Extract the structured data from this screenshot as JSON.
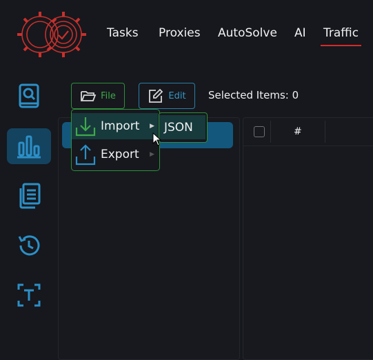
{
  "nav": {
    "items": [
      {
        "label": "Tasks"
      },
      {
        "label": "Proxies"
      },
      {
        "label": "AutoSolve"
      },
      {
        "label": "AI"
      },
      {
        "label": "Traffic"
      }
    ],
    "active": "Traffic"
  },
  "sidebar": {
    "icons": [
      "search-book-icon",
      "bar-chart-icon",
      "documents-icon",
      "history-icon",
      "text-box-icon"
    ],
    "active": "bar-chart-icon"
  },
  "toolbar": {
    "file_label": "File",
    "edit_label": "Edit",
    "selected_items": "Selected Items: 0"
  },
  "file_menu": {
    "items": [
      {
        "label": "Import",
        "icon": "download-icon"
      },
      {
        "label": "Export",
        "icon": "upload-icon"
      }
    ],
    "submenu": {
      "items": [
        {
          "label": "JSON"
        }
      ]
    }
  },
  "table": {
    "columns": [
      "#"
    ]
  },
  "colors": {
    "accent_blue": "#2c8fc7",
    "accent_green": "#2f8f3c",
    "nav_underline": "#d62b2b",
    "background": "#16181d"
  }
}
